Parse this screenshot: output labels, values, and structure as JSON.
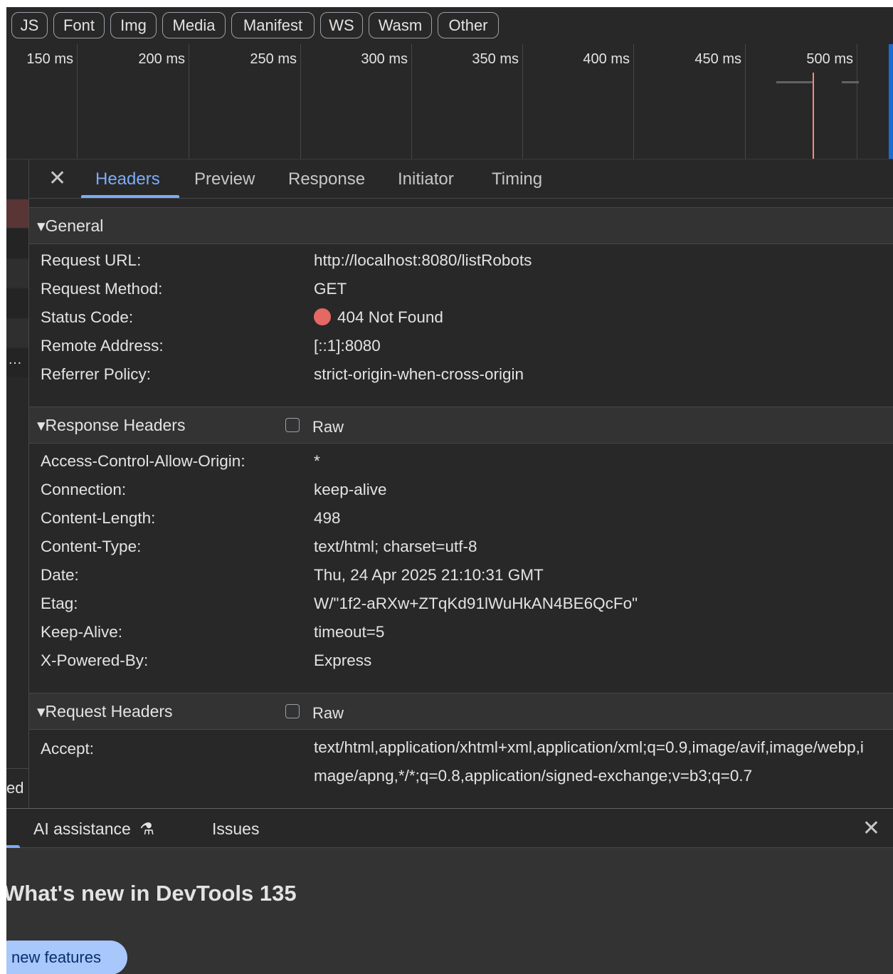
{
  "filters": [
    "JS",
    "Font",
    "Img",
    "Media",
    "Manifest",
    "WS",
    "Wasm",
    "Other"
  ],
  "timeline": {
    "ticks": [
      "150 ms",
      "200 ms",
      "250 ms",
      "300 ms",
      "350 ms",
      "400 ms",
      "450 ms",
      "500 ms"
    ]
  },
  "left_strip": {
    "ellipsis": "…",
    "cut_text": "ed"
  },
  "details": {
    "close_icon": "close-icon",
    "tabs": [
      "Headers",
      "Preview",
      "Response",
      "Initiator",
      "Timing"
    ],
    "active_tab": "Headers",
    "general": {
      "title": "General",
      "rows": [
        {
          "key": "Request URL:",
          "value": "http://localhost:8080/listRobots"
        },
        {
          "key": "Request Method:",
          "value": "GET"
        },
        {
          "key": "Status Code:",
          "value": "404 Not Found"
        },
        {
          "key": "Remote Address:",
          "value": "[::1]:8080"
        },
        {
          "key": "Referrer Policy:",
          "value": "strict-origin-when-cross-origin"
        }
      ]
    },
    "response_headers": {
      "title": "Response Headers",
      "raw_label": "Raw",
      "rows": [
        {
          "key": "Access-Control-Allow-Origin:",
          "value": "*"
        },
        {
          "key": "Connection:",
          "value": "keep-alive"
        },
        {
          "key": "Content-Length:",
          "value": "498"
        },
        {
          "key": "Content-Type:",
          "value": "text/html; charset=utf-8"
        },
        {
          "key": "Date:",
          "value": "Thu, 24 Apr 2025 21:10:31 GMT"
        },
        {
          "key": "Etag:",
          "value": "W/\"1f2-aRXw+ZTqKd91lWuHkAN4BE6QcFo\""
        },
        {
          "key": "Keep-Alive:",
          "value": "timeout=5"
        },
        {
          "key": "X-Powered-By:",
          "value": "Express"
        }
      ]
    },
    "request_headers": {
      "title": "Request Headers",
      "raw_label": "Raw",
      "rows": [
        {
          "key": "Accept:",
          "value": "text/html,application/xhtml+xml,application/xml;q=0.9,image/avif,image/webp,image/apng,*/*;q=0.8,application/signed-exchange;v=b3;q=0.7"
        }
      ]
    },
    "status_color": "#e46962"
  },
  "drawer": {
    "tabs": [
      "AI assistance",
      "Issues"
    ],
    "ai_icon": "flask-icon",
    "heading": "What's new in DevTools 135",
    "button": "new features"
  }
}
